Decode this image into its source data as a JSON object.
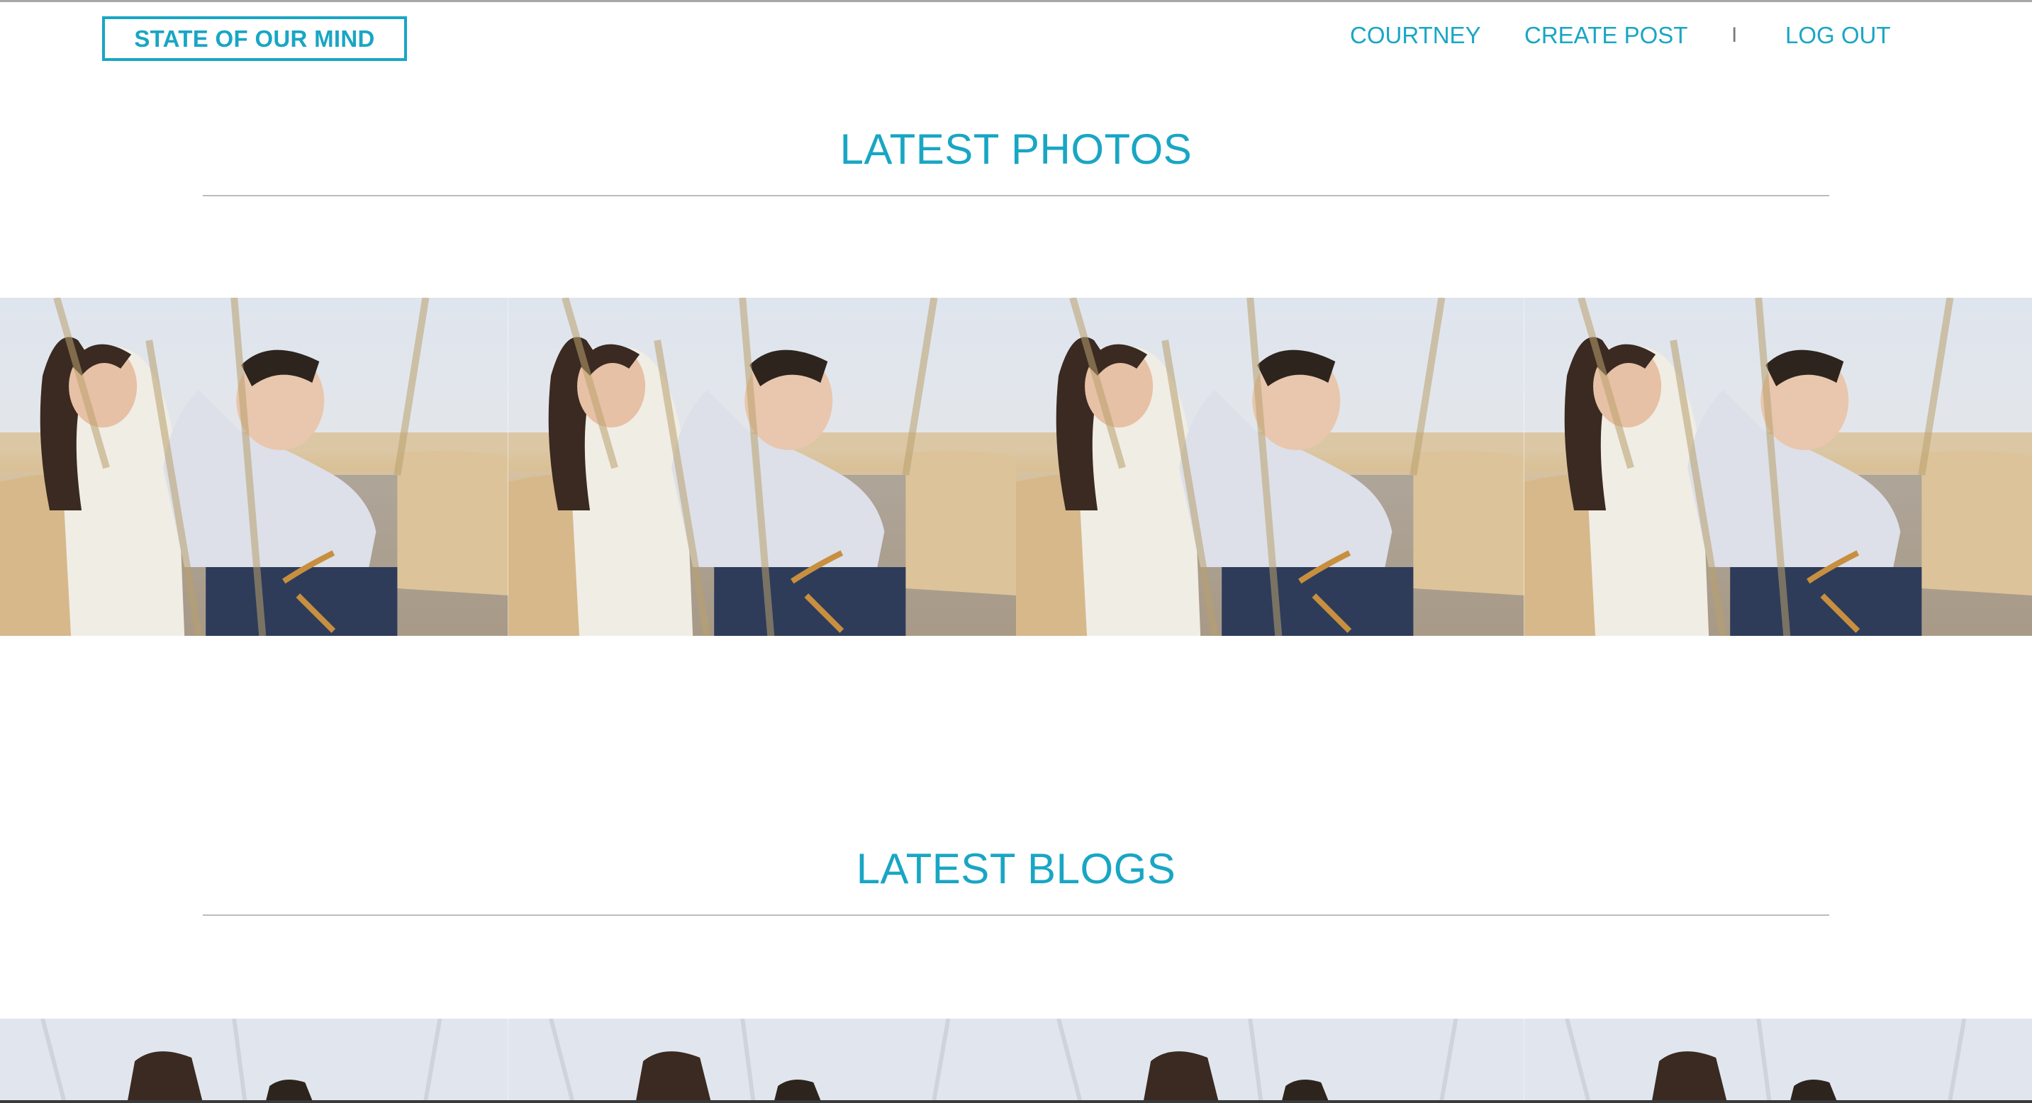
{
  "header": {
    "brand": "STATE OF OUR MIND",
    "nav": {
      "user": "COURTNEY",
      "create_post": "CREATE POST",
      "separator": "I",
      "log_out": "LOG OUT"
    }
  },
  "sections": {
    "photos_title": "LATEST PHOTOS",
    "blogs_title": "LATEST BLOGS"
  },
  "colors": {
    "accent": "#19a6c4"
  },
  "photos": {
    "description_icon": "couple-photo",
    "count": 4
  }
}
